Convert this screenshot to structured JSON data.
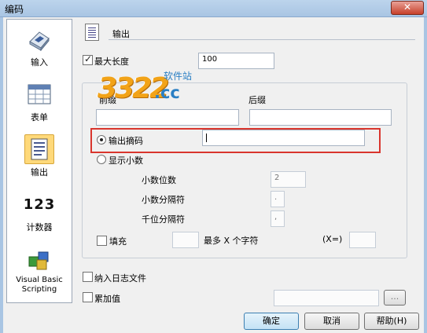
{
  "window": {
    "title": "编码",
    "close_icon": "close-icon",
    "watermark": ""
  },
  "sidebar": {
    "items": [
      {
        "label": "输入",
        "icon": "keyboard-icon"
      },
      {
        "label": "表单",
        "icon": "table-icon"
      },
      {
        "label": "输出",
        "icon": "document-icon",
        "selected": true
      },
      {
        "label": "计数器",
        "icon": "counter-icon",
        "glyph": "123"
      },
      {
        "label": "Visual Basic Scripting",
        "line1": "Visual Basic",
        "line2": "Scripting",
        "icon": "vb-script-icon"
      }
    ]
  },
  "main": {
    "header_title": "输出",
    "max_length": {
      "label": "最大长度",
      "checked": true,
      "value": "100"
    },
    "prefix_label": "前缀",
    "suffix_label": "后缀",
    "output_digest": {
      "label": "输出摘码",
      "selected": true,
      "value": ""
    },
    "show_decimal": {
      "label": "显示小数",
      "selected": false
    },
    "decimal_places": {
      "label": "小数位数",
      "value": "2"
    },
    "decimal_separator": {
      "label": "小数分隔符",
      "value": "."
    },
    "thousands_separator": {
      "label": "千位分隔符",
      "value": ","
    },
    "pad": {
      "label": "填充",
      "checked": false,
      "value": "",
      "most_label": "最多 X 个字符",
      "x_label": "(X=)",
      "x_value": ""
    },
    "log_file": {
      "label": "纳入日志文件",
      "checked": false
    },
    "accumulate": {
      "label": "累加值",
      "checked": false,
      "value": "",
      "browse": "..."
    }
  },
  "buttons": {
    "ok": "确定",
    "cancel": "取消",
    "help": "帮助(H)"
  },
  "watermark_logo": {
    "number": "3322",
    "domain": ".cc",
    "text": "软件站"
  },
  "colors": {
    "highlight": "#d9352d",
    "selected_bg": "#ffd97a",
    "title_bar": "#a9c5e3"
  }
}
